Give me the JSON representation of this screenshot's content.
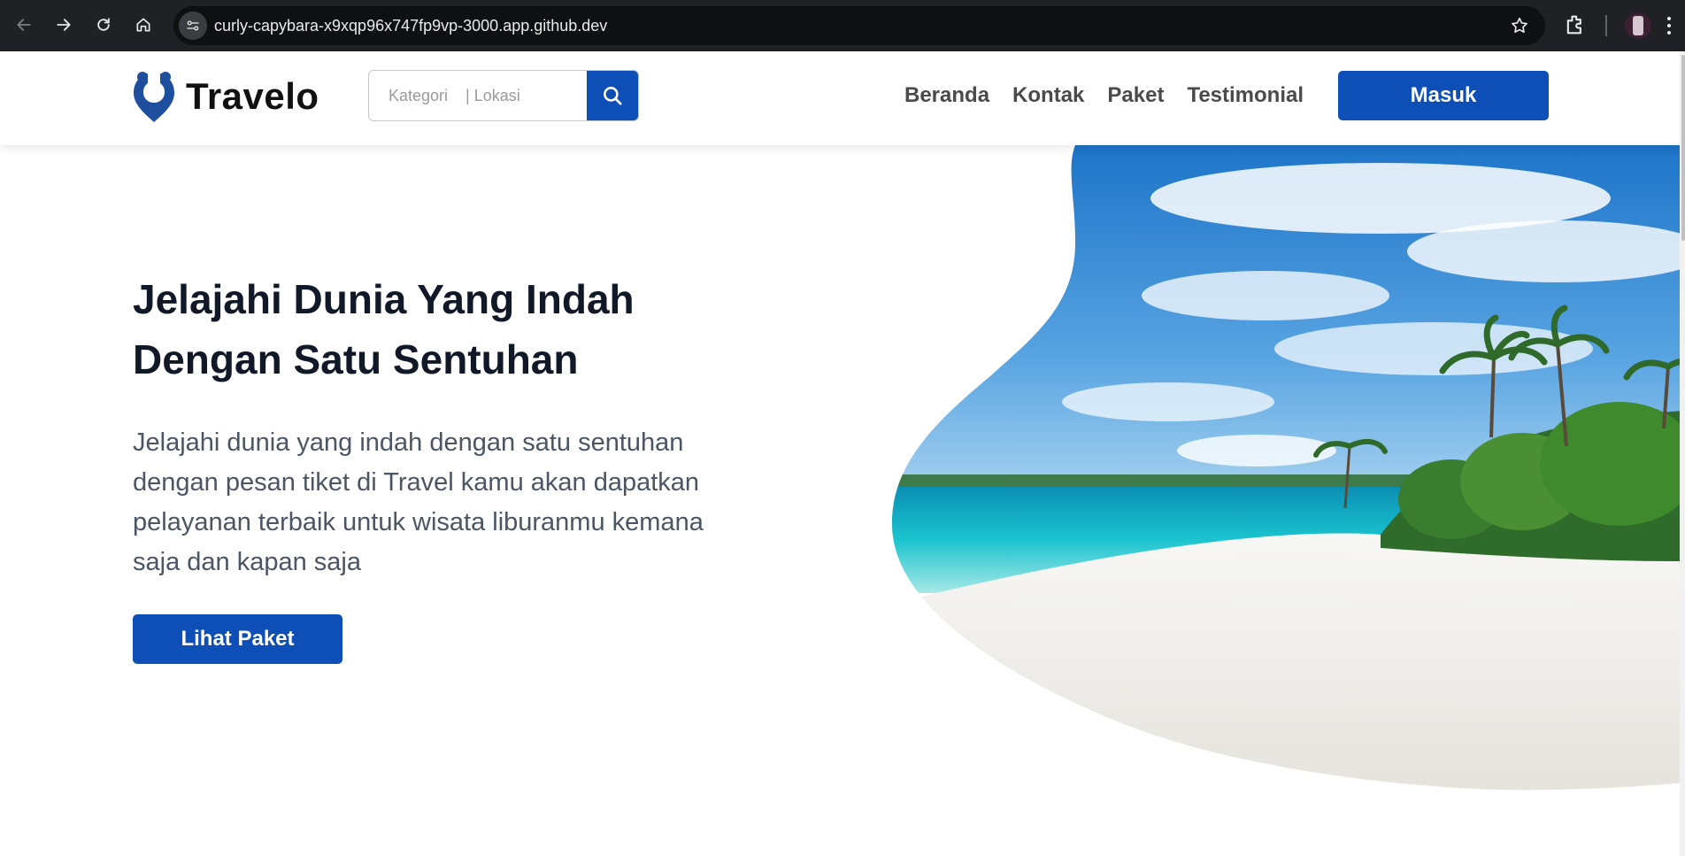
{
  "browser": {
    "url": "curly-capybara-x9xqp96x747fp9vp-3000.app.github.dev",
    "icons": [
      "back-icon",
      "forward-icon",
      "reload-icon",
      "home-icon",
      "site-settings-icon",
      "bookmark-star-icon",
      "extensions-icon",
      "profile-avatar",
      "more-menu-icon"
    ]
  },
  "navbar": {
    "logo_text": "Travelo",
    "search": {
      "placeholder": "Kategori    | Lokasi"
    },
    "links": [
      "Beranda",
      "Kontak",
      "Paket",
      "Testimonial"
    ],
    "login_label": "Masuk"
  },
  "hero": {
    "title": "Jelajahi Dunia Yang Indah Dengan Satu Sentuhan",
    "description": "Jelajahi dunia yang indah dengan satu sentuhan dengan pesan tiket di Travel kamu akan dapatkan pelayanan terbaik untuk wisata liburanmu kemana saja dan kapan saja",
    "cta_label": "Lihat Paket"
  },
  "colors": {
    "primary": "#0e4fb7",
    "heading": "#111827",
    "body_text": "#4b5563",
    "nav_text": "#4a4a4a"
  }
}
